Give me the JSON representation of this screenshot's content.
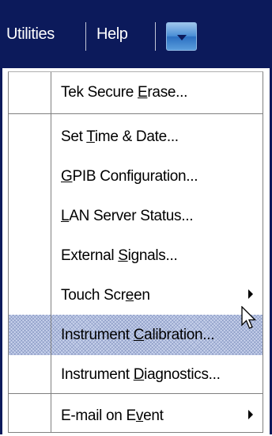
{
  "menubar": {
    "utilities_label": "Utilities",
    "help_label": "Help",
    "dropdown_icon": "chevron-down-icon"
  },
  "menu": {
    "items": [
      {
        "pre": "Tek Secure ",
        "mnemonic": "E",
        "post": "rase...",
        "submenu": false
      },
      {
        "pre": "Set ",
        "mnemonic": "T",
        "post": "ime & Date...",
        "submenu": false
      },
      {
        "pre": "",
        "mnemonic": "G",
        "post": "PIB Configuration...",
        "submenu": false
      },
      {
        "pre": "",
        "mnemonic": "L",
        "post": "AN Server Status...",
        "submenu": false
      },
      {
        "pre": "External ",
        "mnemonic": "S",
        "post": "ignals...",
        "submenu": false
      },
      {
        "pre": "Touch Scr",
        "mnemonic": "e",
        "post": "en",
        "submenu": true
      },
      {
        "pre": "Instrument ",
        "mnemonic": "C",
        "post": "alibration...",
        "submenu": false,
        "highlighted": true
      },
      {
        "pre": "Instrument ",
        "mnemonic": "D",
        "post": "iagnostics...",
        "submenu": false
      },
      {
        "pre": "E-mail on E",
        "mnemonic": "v",
        "post": "ent",
        "submenu": true
      }
    ]
  },
  "colors": {
    "menubar_bg": "#0c1a5b",
    "highlight": "#c9d3ec",
    "dropdown_button": "#4b8fd6"
  },
  "cursor": {
    "icon": "mouse-pointer-icon"
  }
}
